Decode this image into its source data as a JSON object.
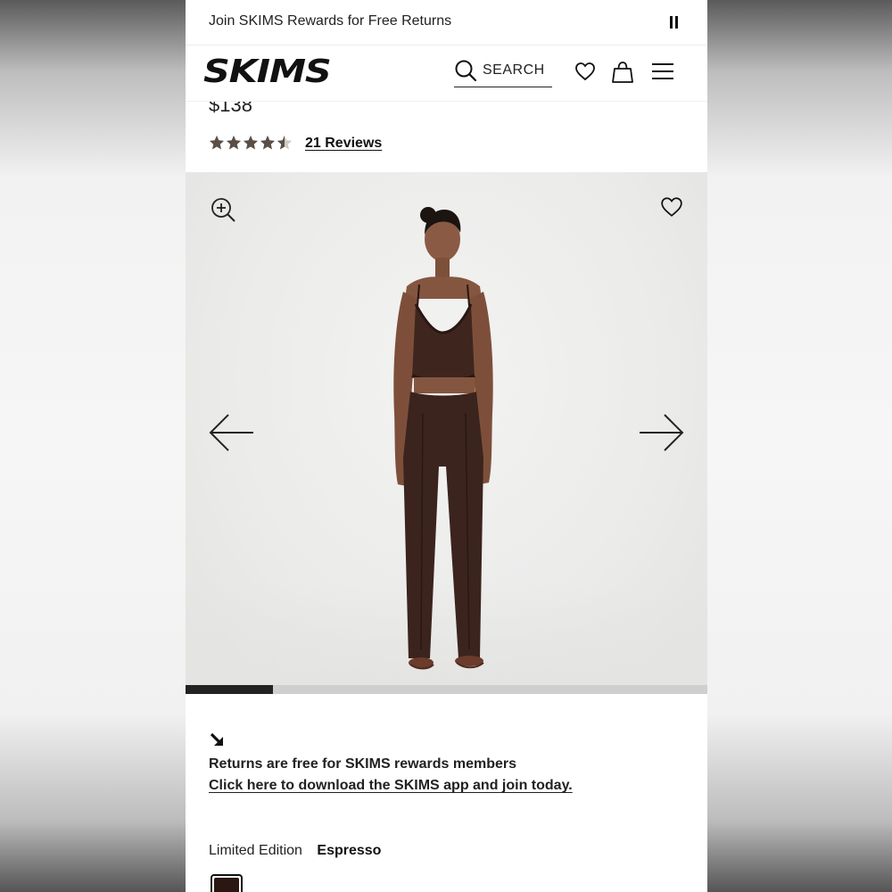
{
  "promo": {
    "text": "Join SKIMS Rewards for Free Returns"
  },
  "header": {
    "logo": "SKIMS",
    "search_label": "SEARCH"
  },
  "product": {
    "price": "$138",
    "rating": 4.5,
    "reviews_label": "21 Reviews"
  },
  "gallery": {
    "progress_fraction": 0.167
  },
  "returns": {
    "line1": "Returns are free for SKIMS rewards members",
    "line2": "Click here to download the SKIMS app and join today."
  },
  "color": {
    "label": "Limited Edition",
    "value": "Espresso",
    "swatch_color": "#2a1712"
  },
  "colors": {
    "accent": "#111111",
    "product": "#3b241d"
  }
}
